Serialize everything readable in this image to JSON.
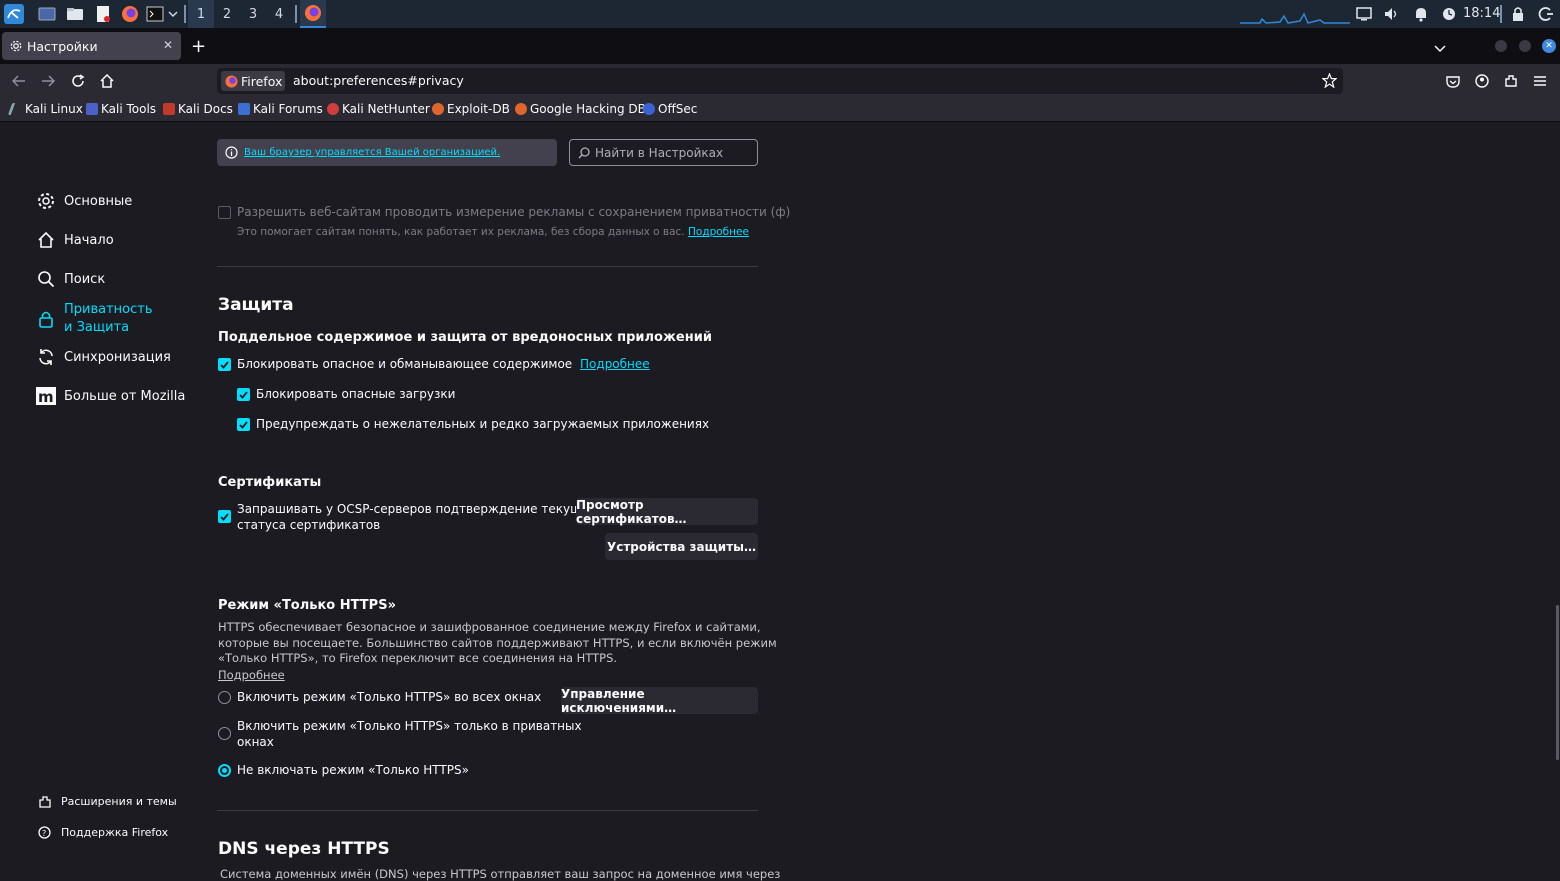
{
  "panel": {
    "workspaces": [
      "1",
      "2",
      "3",
      "4"
    ],
    "time": "18:14",
    "colors": {
      "panel_bg": "#1d2633",
      "kali_blue": "#2f88d8"
    }
  },
  "tab": {
    "title": "Настройки"
  },
  "urlbar": {
    "identity": "Firefox",
    "url": "about:preferences#privacy"
  },
  "bookmarks": [
    "Kali Linux",
    "Kali Tools",
    "Kali Docs",
    "Kali Forums",
    "Kali NetHunter",
    "Exploit-DB",
    "Google Hacking DB",
    "OffSec"
  ],
  "sidebar": {
    "items": [
      {
        "label": "Основные",
        "icon": "gear-icon"
      },
      {
        "label": "Начало",
        "icon": "home-icon"
      },
      {
        "label": "Поиск",
        "icon": "search-icon"
      },
      {
        "label": "Приватность и Защита",
        "icon": "lock-icon",
        "active": true
      },
      {
        "label": "Синхронизация",
        "icon": "sync-icon"
      },
      {
        "label": "Больше от Mozilla",
        "icon": "mozilla-icon"
      }
    ],
    "footer": [
      "Расширения и темы",
      "Поддержка Firefox"
    ]
  },
  "header": {
    "org_notice": "Ваш браузер управляется Вашей организацией.",
    "search_placeholder": "Найти в Настройках"
  },
  "ads": {
    "checkbox_label": "Разрешить веб-сайтам проводить измерение рекламы с сохранением приватности (ф)",
    "description": "Это помогает сайтам понять, как работает их реклама, без сбора данных о вас.",
    "learn_more": "Подробнее"
  },
  "security": {
    "title": "Защита",
    "subtitle": "Поддельное содержимое и защита от вредоносных приложений",
    "block_dangerous": "Блокировать опасное и обманывающее содержимое",
    "learn_more": "Подробнее",
    "block_downloads": "Блокировать опасные загрузки",
    "warn_unwanted": "Предупреждать о нежелательных и редко загружаемых приложениях"
  },
  "certificates": {
    "title": "Сертификаты",
    "ocsp_line1": "Запрашивать у OCSP-серверов подтверждение текущего",
    "ocsp_line2": "статуса сертификатов",
    "view_button": "Просмотр сертификатов…",
    "devices_button": "Устройства защиты…"
  },
  "https_only": {
    "title": "Режим «Только HTTPS»",
    "desc_line1": "HTTPS обеспечивает безопасное и зашифрованное соединение между Firefox и сайтами,",
    "desc_line2": "которые вы посещаете. Большинство сайтов поддерживают HTTPS, и если включён режим",
    "desc_line3": "«Только HTTPS», то Firefox переключит все соединения на HTTPS.",
    "learn_more": "Подробнее",
    "opt_all": "Включить режим «Только HTTPS» во всех окнах",
    "opt_private_line1": "Включить режим «Только HTTPS» только в приватных",
    "opt_private_line2": "окнах",
    "opt_off": "Не включать режим «Только HTTPS»",
    "manage_button": "Управление исключениями…",
    "selected": "opt_off"
  },
  "dns": {
    "title": "DNS через HTTPS",
    "desc": "Система доменных имён (DNS) через HTTPS отправляет ваш запрос на доменное имя через"
  },
  "colors": {
    "accent": "#00ddff",
    "bg": "#1c1b22",
    "toolbar": "#2b2a33"
  }
}
